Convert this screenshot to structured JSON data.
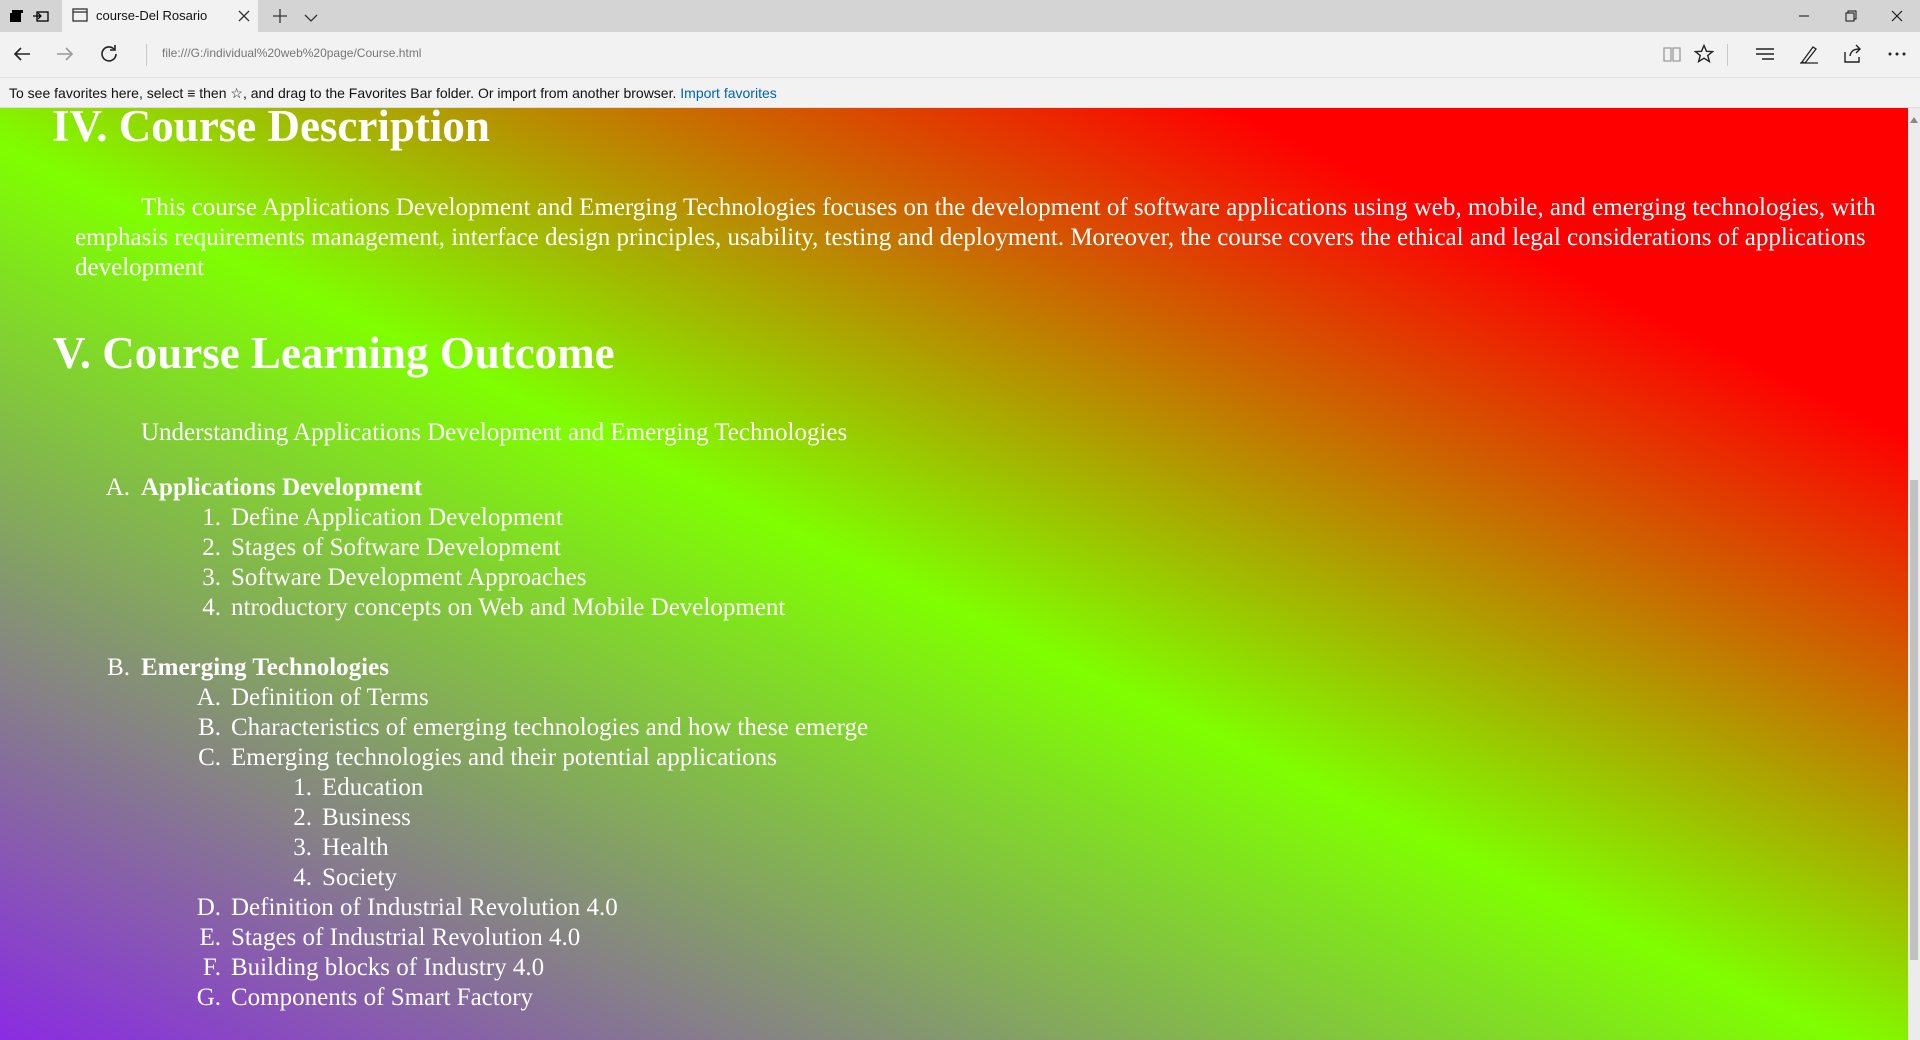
{
  "browser": {
    "tab_title": "course-Del Rosario",
    "address": "file:///G:/individual%20web%20page/Course.html",
    "favorites_bar": {
      "text": "To see favorites here, select  ≡  then ☆, and drag to the Favorites Bar folder. Or import from another browser.",
      "link": "Import favorites"
    }
  },
  "page": {
    "section4": {
      "heading": "IV. Course Description",
      "paragraph": "This course Applications Development and Emerging Technologies focuses on the development of software applications using web, mobile, and emerging technologies, with emphasis requirements management, interface design principles, usability, testing and deployment. Moreover, the course covers the ethical and legal considerations of applications development"
    },
    "section5": {
      "heading": "V. Course Learning Outcome",
      "intro": "Understanding Applications Development and Emerging Technologies",
      "part_a": {
        "marker": "A.",
        "title": "Applications Development",
        "items": [
          {
            "marker": "1.",
            "text": "Define Application Development"
          },
          {
            "marker": "2.",
            "text": "Stages of Software Development"
          },
          {
            "marker": "3.",
            "text": "Software Development Approaches"
          },
          {
            "marker": "4.",
            "text": "ntroductory concepts on Web and Mobile Development"
          }
        ]
      },
      "part_b": {
        "marker": "B.",
        "title": "Emerging Technologies",
        "items": [
          {
            "marker": "A.",
            "text": "Definition of Terms"
          },
          {
            "marker": "B.",
            "text": "Characteristics of emerging technologies and how these emerge"
          },
          {
            "marker": "C.",
            "text": "Emerging technologies and their potential applications"
          },
          {
            "marker": "1.",
            "text": "Education"
          },
          {
            "marker": "2.",
            "text": "Business"
          },
          {
            "marker": "3.",
            "text": "Health"
          },
          {
            "marker": "4.",
            "text": "Society"
          },
          {
            "marker": "D.",
            "text": "Definition of Industrial Revolution 4.0"
          },
          {
            "marker": "E.",
            "text": "Stages of Industrial Revolution 4.0"
          },
          {
            "marker": "F.",
            "text": "Building blocks of Industry 4.0"
          },
          {
            "marker": "G.",
            "text": "Components of Smart Factory"
          }
        ]
      }
    }
  },
  "colors": {
    "gradient_start": "#8a2be2",
    "gradient_mid": "#7fff00",
    "gradient_end": "#ff0000",
    "text": "#ffffff",
    "link": "#0063b1"
  }
}
